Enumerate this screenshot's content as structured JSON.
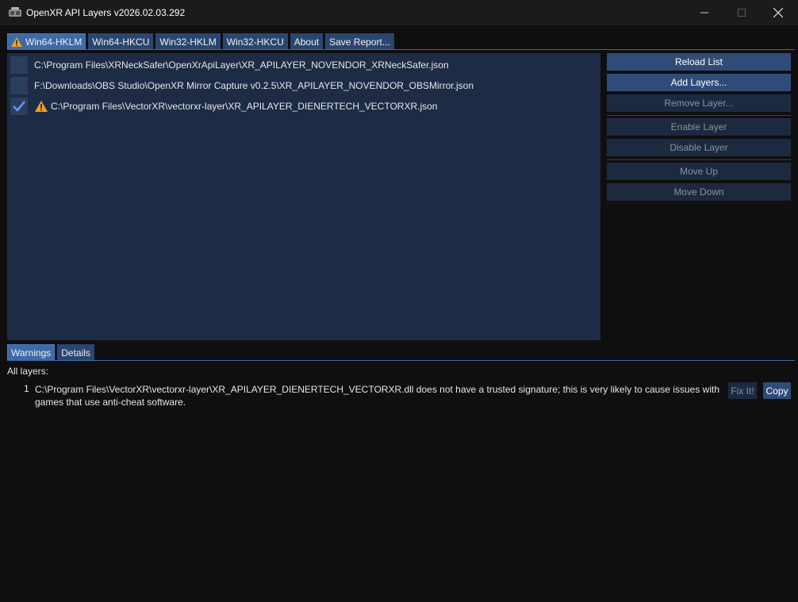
{
  "window": {
    "title": "OpenXR API Layers v2026.02.03.292",
    "app_icon": "vr-headset-icon"
  },
  "tabs_top": [
    {
      "label": "Win64-HKLM",
      "active": true,
      "warning": true
    },
    {
      "label": "Win64-HKCU",
      "active": false
    },
    {
      "label": "Win32-HKLM",
      "active": false
    },
    {
      "label": "Win32-HKCU",
      "active": false
    },
    {
      "label": "About",
      "active": false
    },
    {
      "label": "Save Report...",
      "active": false
    }
  ],
  "layers": [
    {
      "path": "C:\\Program Files\\XRNeckSafer\\OpenXrApiLayer\\XR_APILAYER_NOVENDOR_XRNeckSafer.json",
      "enabled": false,
      "warning": false
    },
    {
      "path": "F:\\Downloads\\OBS Studio\\OpenXR Mirror Capture v0.2.5\\XR_APILAYER_NOVENDOR_OBSMirror.json",
      "enabled": false,
      "warning": false
    },
    {
      "path": "C:\\Program Files\\VectorXR\\vectorxr-layer\\XR_APILAYER_DIENERTECH_VECTORXR.json",
      "enabled": true,
      "warning": true
    }
  ],
  "buttons": {
    "reload": "Reload List",
    "add": "Add Layers...",
    "remove": "Remove Layer...",
    "enable": "Enable Layer",
    "disable": "Disable Layer",
    "move_up": "Move Up",
    "move_down": "Move Down"
  },
  "tabs_bottom": [
    {
      "label": "Warnings",
      "active": true
    },
    {
      "label": "Details",
      "active": false
    }
  ],
  "warnings": {
    "heading": "All layers:",
    "items": [
      {
        "number": "1",
        "text": "C:\\Program Files\\VectorXR\\vectorxr-layer\\XR_APILAYER_DIENERTECH_VECTORXR.dll does not have a trusted signature; this is very likely to cause issues with games that use anti-cheat software.",
        "fix_label": "Fix It!",
        "copy_label": "Copy"
      }
    ]
  },
  "colors": {
    "accent": "#3d6aa8",
    "list_bg": "#1e2b45",
    "warning": "#f0a020"
  }
}
